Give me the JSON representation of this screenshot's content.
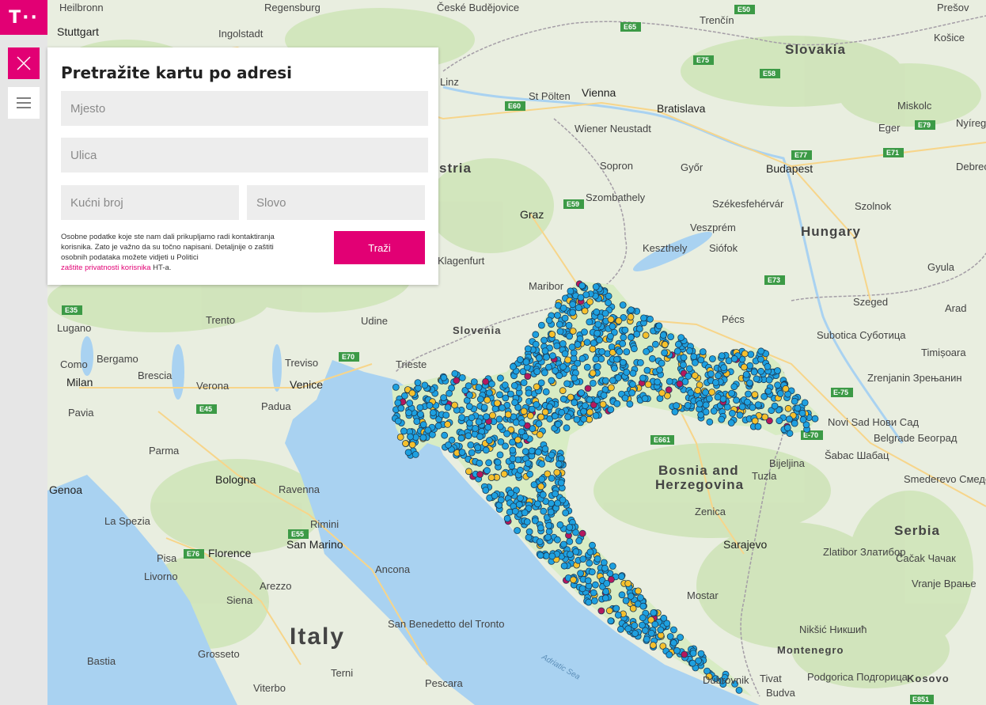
{
  "brand": {
    "logo_text": "T··",
    "accent_color": "#e20074"
  },
  "sidebar": {
    "close_icon": "close-icon",
    "menu_icon": "hamburger-menu-icon"
  },
  "search_panel": {
    "title": "Pretražite kartu po adresi",
    "fields": {
      "city_placeholder": "Mjesto",
      "street_placeholder": "Ulica",
      "house_number_placeholder": "Kućni broj",
      "letter_placeholder": "Slovo"
    },
    "notice_text": "Osobne podatke koje ste nam dali prikupljamo radi kontaktiranja korisnika. Zato je važno da su točno napisani. Detaljnije o zaštiti osobnih podataka možete vidjeti u Politici",
    "privacy_link": "zaštite privatnosti korisnika",
    "notice_suffix": "HT-a.",
    "search_button": "Traži"
  },
  "map": {
    "countries": [
      "Slovakia",
      "Hungary",
      "Slovenia",
      "Bosnia and",
      "Herzegovina",
      "Serbia",
      "Montenegro",
      "Kosovo",
      "Italy",
      "stria"
    ],
    "cities": [
      "Heilbronn",
      "Stuttgart",
      "Regensburg",
      "Ingolstadt",
      "České Budějovice",
      "Trenčín",
      "Prešov",
      "Košice",
      "Linz",
      "St Pölten",
      "Vienna",
      "Bratislava",
      "Wiener Neustadt",
      "Sopron",
      "Győr",
      "Budapest",
      "Miskolc",
      "Eger",
      "Nyíregy",
      "Debrec",
      "Szombathely",
      "Székesfehérvár",
      "Szolnok",
      "Graz",
      "Veszprém",
      "Keszthely",
      "Siófok",
      "Maribor",
      "Klagenfurt",
      "Pécs",
      "Szeged",
      "Gyula",
      "Arad",
      "Lugano",
      "Trento",
      "Udine",
      "Bergamo",
      "Como",
      "Brescia",
      "Milan",
      "Treviso",
      "Verona",
      "Venice",
      "Trieste",
      "Padua",
      "Pavia",
      "Parma",
      "Bologna",
      "Ravenna",
      "Genoa",
      "La Spezia",
      "Rimini",
      "San Marino",
      "Florence",
      "Livorno",
      "Pisa",
      "Ancona",
      "Arezzo",
      "Siena",
      "San Benedetto del Tronto",
      "Grosseto",
      "Bastia",
      "Terni",
      "Viterbo",
      "Pescara",
      "Subotica Суботица",
      "Timișoara",
      "Zrenjanin Зрењанин",
      "Novi Sad Нови Сад",
      "Belgrade Београд",
      "Bijeljina",
      "Šabac Шабац",
      "Tuzla",
      "Zenica",
      "Sarajevo",
      "Mostar",
      "Smederevo Смедерево",
      "Čačak Чачак",
      "Zlatibor Златибор",
      "Vranje Врање",
      "Nikšić Никшић",
      "Podgorica Подгорица",
      "Dubrovnik",
      "Tivat",
      "Budva"
    ],
    "sea_label": "Adriatic Sea",
    "highways": [
      "E50",
      "E65",
      "E75",
      "E58",
      "E79",
      "E60",
      "E71",
      "E77",
      "E59",
      "E73",
      "E35",
      "E70",
      "E45",
      "E55",
      "E76",
      "E661",
      "E-75",
      "E-70",
      "E851"
    ],
    "colors": {
      "water": "#a9d2f1",
      "land": "#e9eee0",
      "forest": "#cfe4b9",
      "marker_blue": "#1ea0e0",
      "marker_yellow": "#f6c02c",
      "marker_magenta": "#b4185e"
    }
  }
}
